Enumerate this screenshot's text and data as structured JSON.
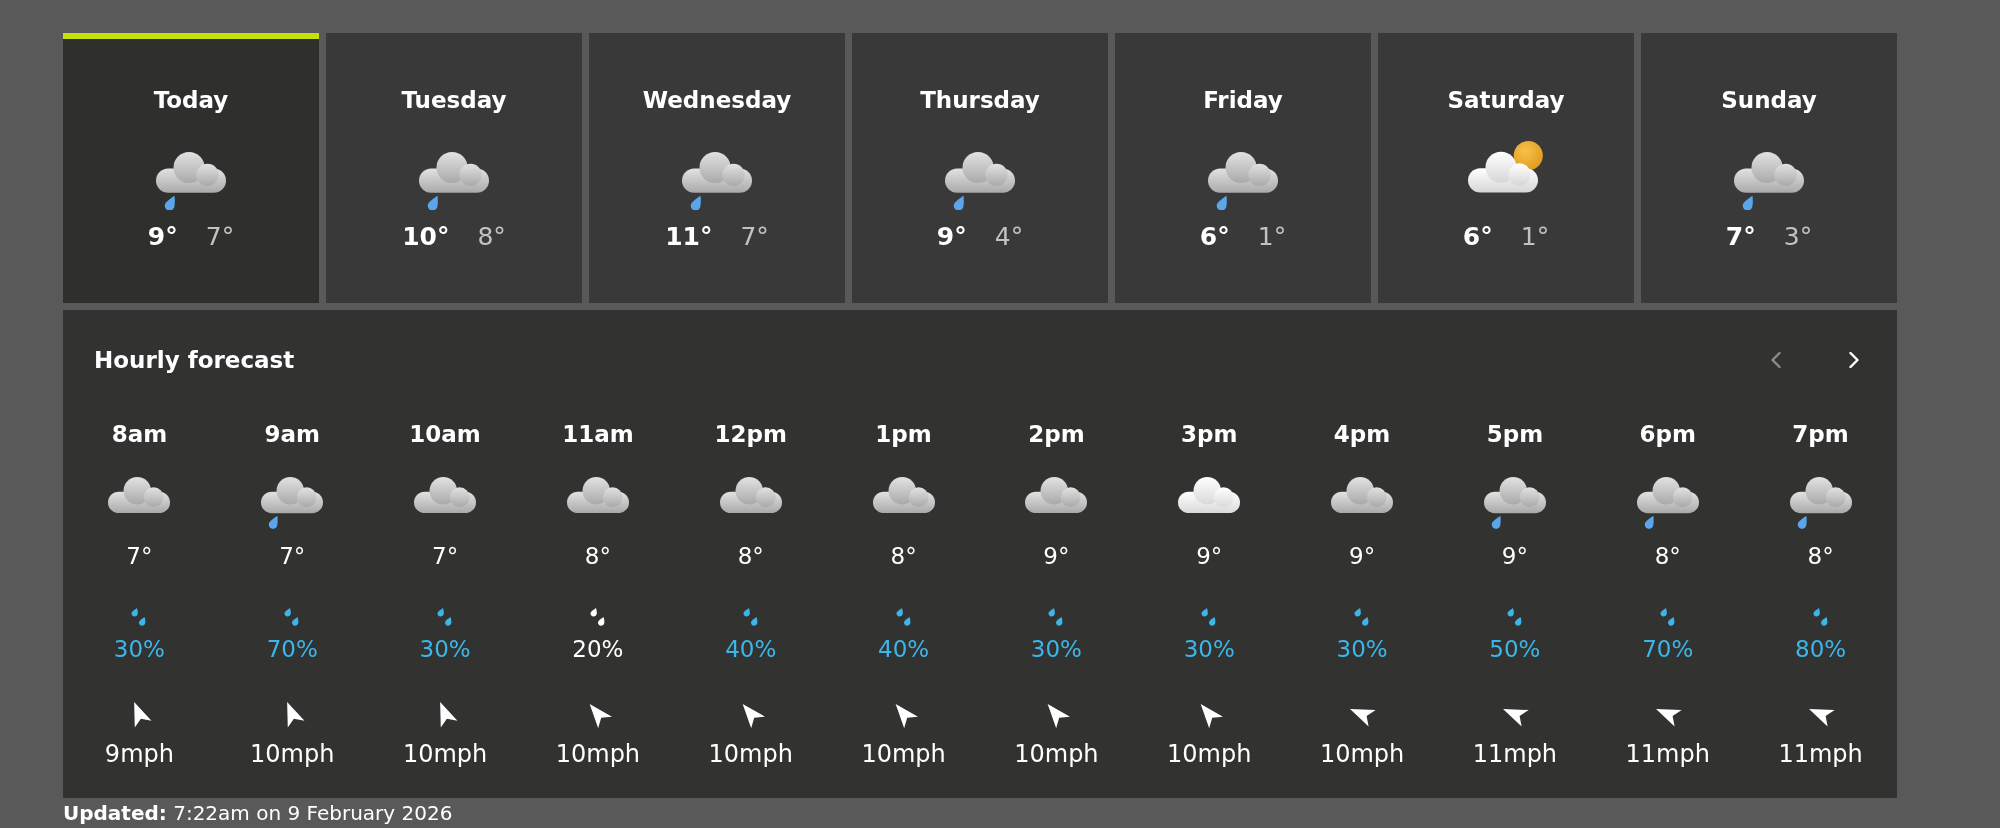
{
  "days": [
    {
      "name": "Today",
      "kind": "drizzle",
      "high": "9°",
      "low": "7°",
      "selected": true
    },
    {
      "name": "Tuesday",
      "kind": "drizzle",
      "high": "10°",
      "low": "8°",
      "selected": false
    },
    {
      "name": "Wednesday",
      "kind": "drizzle",
      "high": "11°",
      "low": "7°",
      "selected": false
    },
    {
      "name": "Thursday",
      "kind": "drizzle",
      "high": "9°",
      "low": "4°",
      "selected": false
    },
    {
      "name": "Friday",
      "kind": "drizzle",
      "high": "6°",
      "low": "1°",
      "selected": false
    },
    {
      "name": "Saturday",
      "kind": "suncloud",
      "high": "6°",
      "low": "1°",
      "selected": false
    },
    {
      "name": "Sunday",
      "kind": "drizzle",
      "high": "7°",
      "low": "3°",
      "selected": false
    }
  ],
  "hourly": {
    "title": "Hourly forecast",
    "previous": {
      "disabled": true
    },
    "next": {
      "disabled": false
    },
    "hours": [
      {
        "time": "8am",
        "kind": "cloud",
        "temperature": "7°",
        "color": "#3cb6ea",
        "precipitation": "30%",
        "wind": {
          "kind": "nnw",
          "speed": "9mph"
        }
      },
      {
        "time": "9am",
        "kind": "drizzle",
        "temperature": "7°",
        "color": "#3cb6ea",
        "precipitation": "70%",
        "wind": {
          "kind": "nnw",
          "speed": "10mph"
        }
      },
      {
        "time": "10am",
        "kind": "cloud",
        "temperature": "7°",
        "color": "#3cb6ea",
        "precipitation": "30%",
        "wind": {
          "kind": "nnw",
          "speed": "10mph"
        }
      },
      {
        "time": "11am",
        "kind": "cloud",
        "temperature": "8°",
        "color": "#ffffff",
        "precipitation": "20%",
        "wind": {
          "kind": "nw",
          "speed": "10mph"
        }
      },
      {
        "time": "12pm",
        "kind": "cloud",
        "temperature": "8°",
        "color": "#3cb6ea",
        "precipitation": "40%",
        "wind": {
          "kind": "nw",
          "speed": "10mph"
        }
      },
      {
        "time": "1pm",
        "kind": "cloud",
        "temperature": "8°",
        "color": "#3cb6ea",
        "precipitation": "40%",
        "wind": {
          "kind": "nw",
          "speed": "10mph"
        }
      },
      {
        "time": "2pm",
        "kind": "cloud",
        "temperature": "9°",
        "color": "#3cb6ea",
        "precipitation": "30%",
        "wind": {
          "kind": "nw",
          "speed": "10mph"
        }
      },
      {
        "time": "3pm",
        "kind": "whitecloud",
        "temperature": "9°",
        "color": "#3cb6ea",
        "precipitation": "30%",
        "wind": {
          "kind": "nw",
          "speed": "10mph"
        }
      },
      {
        "time": "4pm",
        "kind": "cloud",
        "temperature": "9°",
        "color": "#3cb6ea",
        "precipitation": "30%",
        "wind": {
          "kind": "wnw",
          "speed": "10mph"
        }
      },
      {
        "time": "5pm",
        "kind": "drizzle",
        "temperature": "9°",
        "color": "#3cb6ea",
        "precipitation": "50%",
        "wind": {
          "kind": "wnw",
          "speed": "11mph"
        }
      },
      {
        "time": "6pm",
        "kind": "drizzle",
        "temperature": "8°",
        "color": "#3cb6ea",
        "precipitation": "70%",
        "wind": {
          "kind": "wnw",
          "speed": "11mph"
        }
      },
      {
        "time": "7pm",
        "kind": "drizzle",
        "temperature": "8°",
        "color": "#3cb6ea",
        "precipitation": "80%",
        "wind": {
          "kind": "wnw",
          "speed": "11mph"
        }
      }
    ]
  },
  "updated": "**Updated:** 7:22am on 9 February 2026"
}
